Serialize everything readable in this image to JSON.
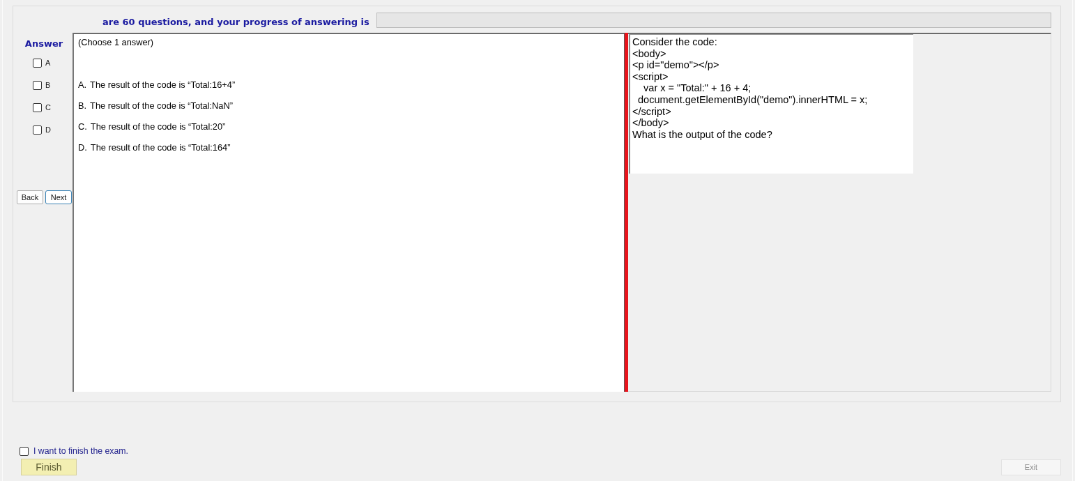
{
  "header": {
    "progress_label": "are 60 questions, and your progress of answering is",
    "progress": {
      "level": 0
    }
  },
  "answer_panel": {
    "title": "Answer",
    "options": [
      {
        "label": "A",
        "checked": false
      },
      {
        "label": "B",
        "checked": false
      },
      {
        "label": "C",
        "checked": false
      },
      {
        "label": "D",
        "checked": false
      }
    ],
    "buttons": [
      {
        "label": "Back",
        "focused": false
      },
      {
        "label": "Next",
        "focused": true
      }
    ]
  },
  "question": {
    "instruction": "(Choose 1 answer)",
    "choices": [
      {
        "letter": "A.",
        "text": "The result of the code is “Total:16+4”"
      },
      {
        "letter": "B.",
        "text": "The result of the code is “Total:NaN”"
      },
      {
        "letter": "C.",
        "text": "The result of the code is “Total:20”"
      },
      {
        "letter": "D.",
        "text": "The result of the code is “Total:164”"
      }
    ]
  },
  "code_panel": {
    "lines": [
      "Consider the code:",
      "<body>",
      "<p id=\"demo\"></p>",
      "<script>",
      "    var x = \"Total:\" + 16 + 4;",
      "  document.getElementById(\"demo\").innerHTML = x;",
      "</script>",
      "</body>",
      "What is the output of the code?"
    ]
  },
  "finish": {
    "label": "I want to finish the exam.",
    "checked": false,
    "buttons": [
      {
        "label": "Finish",
        "disabled": false
      },
      {
        "label": "Exit",
        "disabled": true
      }
    ]
  }
}
